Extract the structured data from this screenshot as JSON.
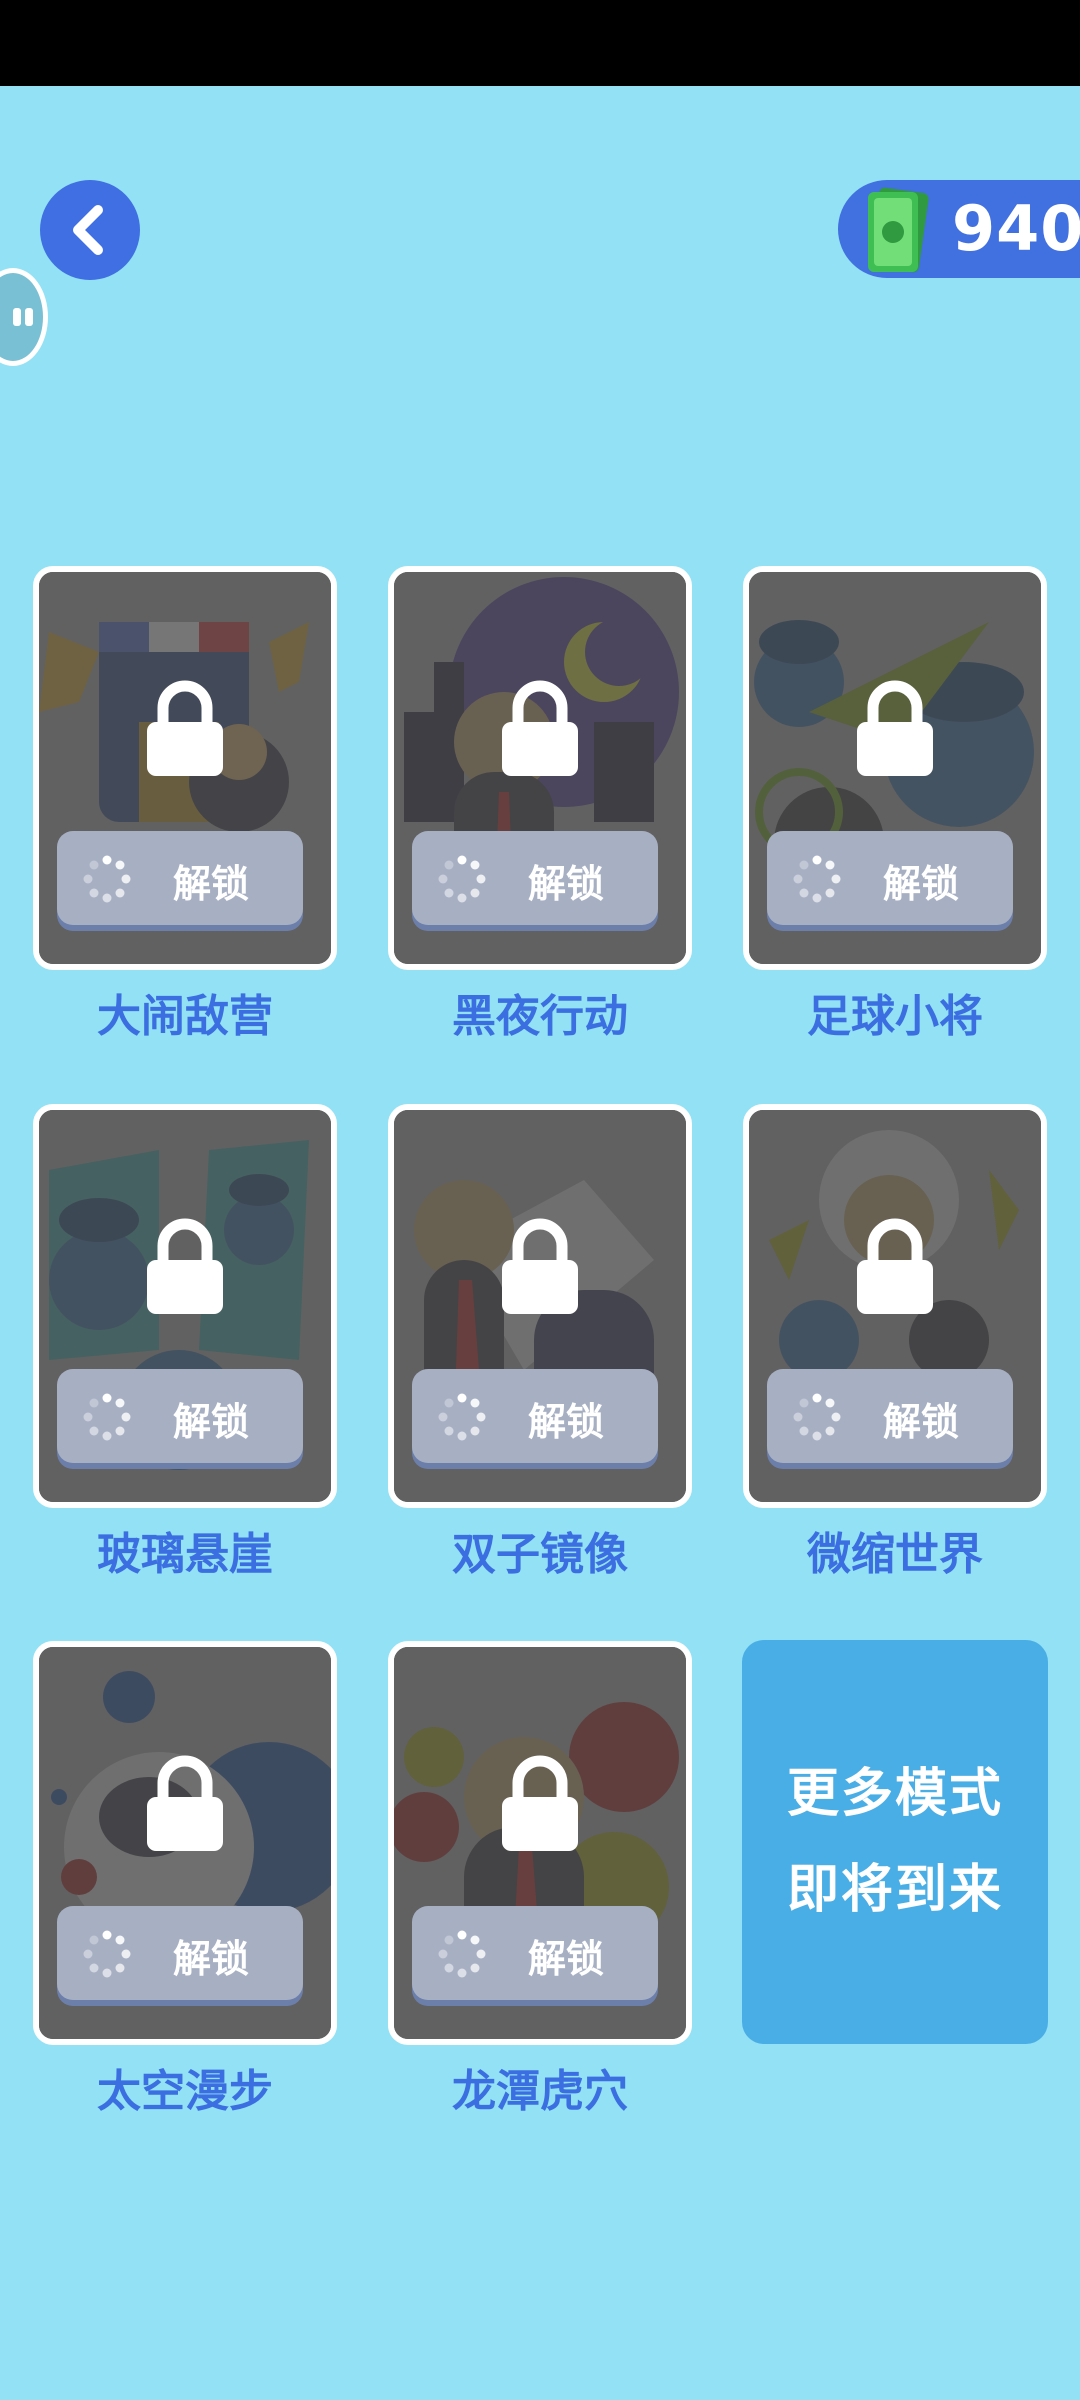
{
  "header": {
    "back_icon": "chevron-left-icon",
    "currency": {
      "icon": "cash-icon",
      "amount": "940"
    }
  },
  "colors": {
    "background": "#93e1f5",
    "accent_blue": "#3f6fe3",
    "title_blue": "#3b6ee1",
    "coming_soon_bg": "#4aaee6"
  },
  "modes": [
    {
      "title": "大闹敌营",
      "button_label": "解锁",
      "locked": true
    },
    {
      "title": "黑夜行动",
      "button_label": "解锁",
      "locked": true
    },
    {
      "title": "足球小将",
      "button_label": "解锁",
      "locked": true
    },
    {
      "title": "玻璃悬崖",
      "button_label": "解锁",
      "locked": true
    },
    {
      "title": "双子镜像",
      "button_label": "解锁",
      "locked": true
    },
    {
      "title": "微缩世界",
      "button_label": "解锁",
      "locked": true
    },
    {
      "title": "太空漫步",
      "button_label": "解锁",
      "locked": true
    },
    {
      "title": "龙潭虎穴",
      "button_label": "解锁",
      "locked": true
    }
  ],
  "coming_soon": {
    "line1": "更多模式",
    "line2": "即将到来"
  }
}
